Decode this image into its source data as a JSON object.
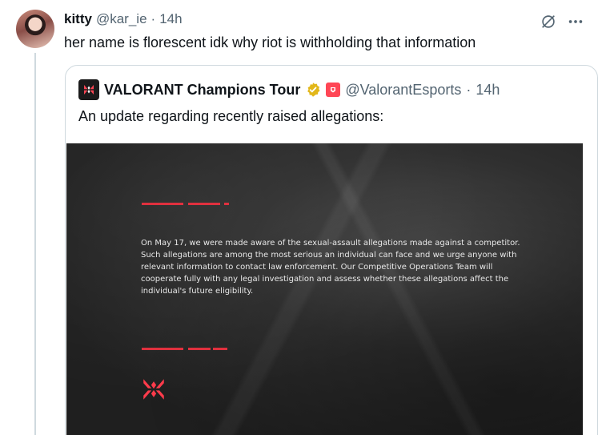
{
  "post": {
    "display_name": "kitty",
    "handle": "@kar_ie",
    "separator": "·",
    "time": "14h",
    "text": "her name is florescent idk why riot is withholding that information"
  },
  "icons": {
    "grok": "grok-icon",
    "more": "more-icon",
    "verified": "verified-badge-icon",
    "affiliation": "affiliate-badge-icon",
    "logo": "vct-logo-icon"
  },
  "quote": {
    "display_name": "VALORANT Champions Tour",
    "handle": "@ValorantEsports",
    "separator": "·",
    "time": "14h",
    "text": "An update regarding recently raised allegations:",
    "image": {
      "statement_lines": [
        "On May 17, we were made aware of the sexual-assault allegations made against a competitor.",
        "Such allegations are among the most serious an individual can face and we urge anyone with",
        "relevant information to contact law enforcement. Our Competitive Operations Team will",
        "cooperate fully with any legal investigation and assess whether these allegations affect the",
        "individual's future eligibility."
      ]
    }
  },
  "colors": {
    "accent_red": "#e0303e",
    "verified_gold": "#e2b719",
    "text_secondary": "#536471"
  }
}
